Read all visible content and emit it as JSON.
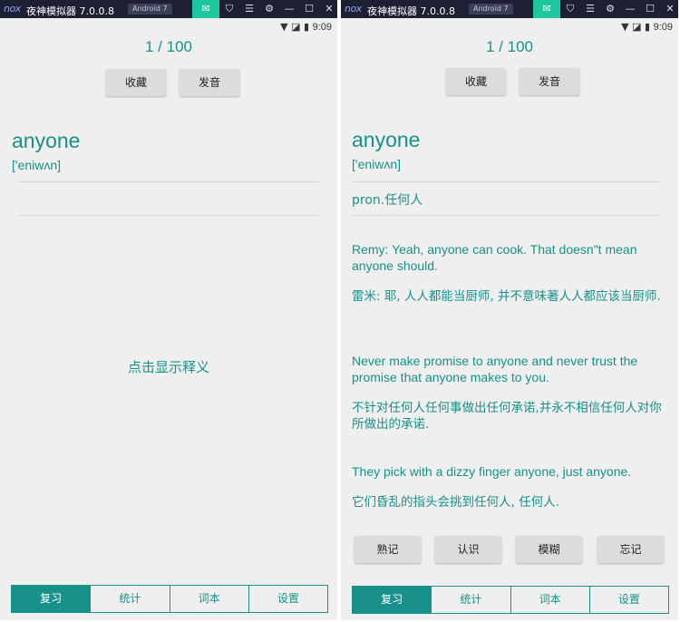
{
  "emulator": {
    "brand": "nox",
    "title": "夜神模拟器 7.0.0.8",
    "android_badge": "Android 7"
  },
  "status": {
    "time": "9:09"
  },
  "card": {
    "counter": "1 / 100",
    "favorite_label": "收藏",
    "pronounce_label": "发音",
    "word": "anyone",
    "phonetic": "['eniwʌn]",
    "reveal_hint": "点击显示释义",
    "definition": "pron.任何人",
    "examples": [
      {
        "en": "Remy: Yeah, anyone can cook. That doesn\"t mean anyone should.",
        "zh": "雷米: 耶, 人人都能当厨师, 并不意味著人人都应该当厨师."
      },
      {
        "en": "Never make promise to anyone and never trust the promise that anyone makes to you.",
        "zh": "不针对任何人任何事做出任何承诺,并永不相信任何人对你所做出的承诺."
      },
      {
        "en": "They pick with a dizzy finger anyone, just anyone.",
        "zh": "它们昏乱的指头会挑到任何人, 任何人."
      }
    ],
    "rating": {
      "known": "熟记",
      "recognized": "认识",
      "vague": "模糊",
      "forgot": "忘记"
    }
  },
  "tabs": {
    "review": "复习",
    "stats": "统计",
    "wordbook": "词本",
    "settings": "设置"
  },
  "colors": {
    "accent": "#17918a",
    "titlebar": "#1d1f33",
    "active_toolbar": "#1ec7a0"
  }
}
